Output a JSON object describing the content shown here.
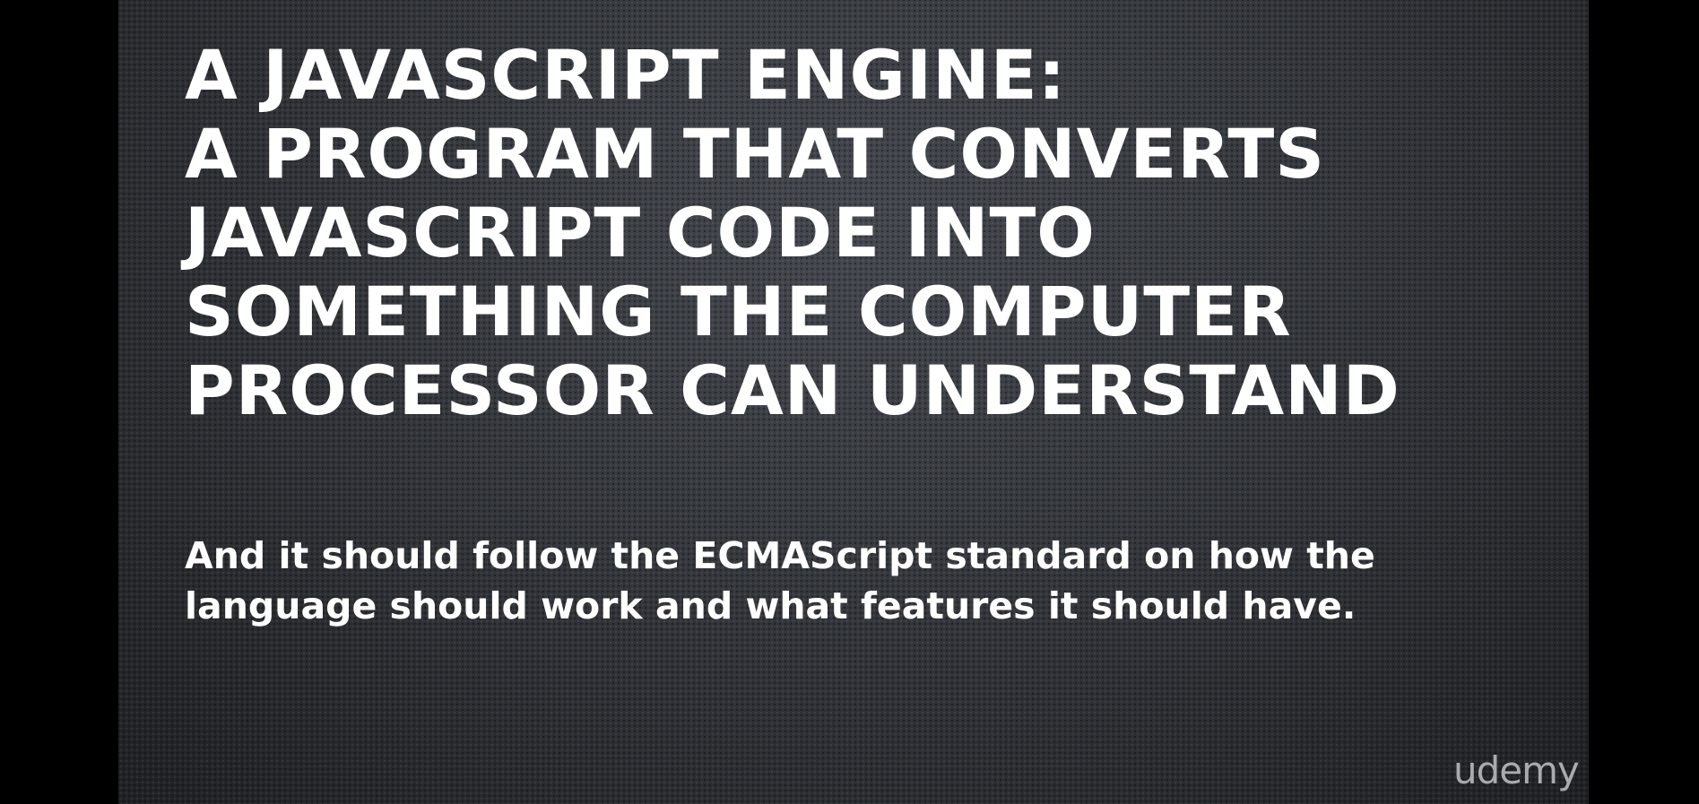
{
  "slide": {
    "heading_lines": [
      "A JAVASCRIPT ENGINE:",
      "A PROGRAM THAT CONVERTS",
      "JAVASCRIPT CODE INTO",
      "SOMETHING THE COMPUTER",
      "PROCESSOR CAN UNDERSTAND"
    ],
    "body_lines": [
      "And it should follow the ECMAScript standard on how the",
      "language should work and what features it should have."
    ]
  },
  "watermark": {
    "text": "udemy"
  },
  "colors": {
    "background": "#000000",
    "slide": "#2b2e33",
    "text": "#ffffff",
    "watermark": "#a9abae"
  }
}
